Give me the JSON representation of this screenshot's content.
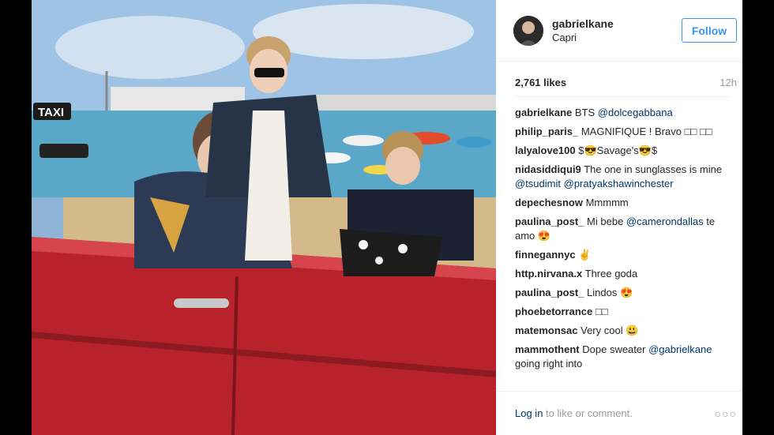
{
  "post": {
    "username": "gabrielkane",
    "location": "Capri",
    "follow_label": "Follow",
    "likes": "2,761 likes",
    "time": "12h",
    "comments": [
      {
        "user": "gabrielkane",
        "parts": [
          {
            "t": "text",
            "v": "BTS "
          },
          {
            "t": "mention",
            "v": "@dolcegabbana"
          }
        ]
      },
      {
        "user": "philip_paris_",
        "parts": [
          {
            "t": "text",
            "v": "MAGNIFIQUE ! Bravo □□ □□"
          }
        ]
      },
      {
        "user": "lalyalove100",
        "parts": [
          {
            "t": "text",
            "v": "$😎Savage's😎$"
          }
        ]
      },
      {
        "user": "nidasiddiqui9",
        "parts": [
          {
            "t": "text",
            "v": "The one in sunglasses is mine "
          },
          {
            "t": "mention",
            "v": "@tsudimit"
          },
          {
            "t": "text",
            "v": " "
          },
          {
            "t": "mention",
            "v": "@pratyakshawinchester"
          }
        ]
      },
      {
        "user": "depechesnow",
        "parts": [
          {
            "t": "text",
            "v": "Mmmmm"
          }
        ]
      },
      {
        "user": "paulina_post_",
        "parts": [
          {
            "t": "text",
            "v": "Mi bebe "
          },
          {
            "t": "mention",
            "v": "@camerondallas"
          },
          {
            "t": "text",
            "v": " te amo 😍"
          }
        ]
      },
      {
        "user": "finnegannyc",
        "parts": [
          {
            "t": "text",
            "v": "✌️"
          }
        ]
      },
      {
        "user": "http.nirvana.x",
        "parts": [
          {
            "t": "text",
            "v": "Three goda"
          }
        ]
      },
      {
        "user": "paulina_post_",
        "parts": [
          {
            "t": "text",
            "v": "Lindos 😍"
          }
        ]
      },
      {
        "user": "phoebetorrance",
        "parts": [
          {
            "t": "text",
            "v": "□□"
          }
        ]
      },
      {
        "user": "matemonsac",
        "parts": [
          {
            "t": "text",
            "v": "Very cool 😃"
          }
        ]
      },
      {
        "user": "mammothent",
        "parts": [
          {
            "t": "text",
            "v": "Dope sweater "
          },
          {
            "t": "mention",
            "v": "@gabrielkane"
          },
          {
            "t": "text",
            "v": " going right into"
          }
        ]
      }
    ]
  },
  "footer": {
    "login_link": "Log in",
    "login_rest": " to like or comment.",
    "more_icon": "more-options-icon",
    "more_glyph": "○○○"
  },
  "photo": {
    "taxi_sign": "TAXI",
    "car_color": "#b8232b",
    "sky_color": "#8fb3d6",
    "sea_color": "#5aa7c8"
  }
}
